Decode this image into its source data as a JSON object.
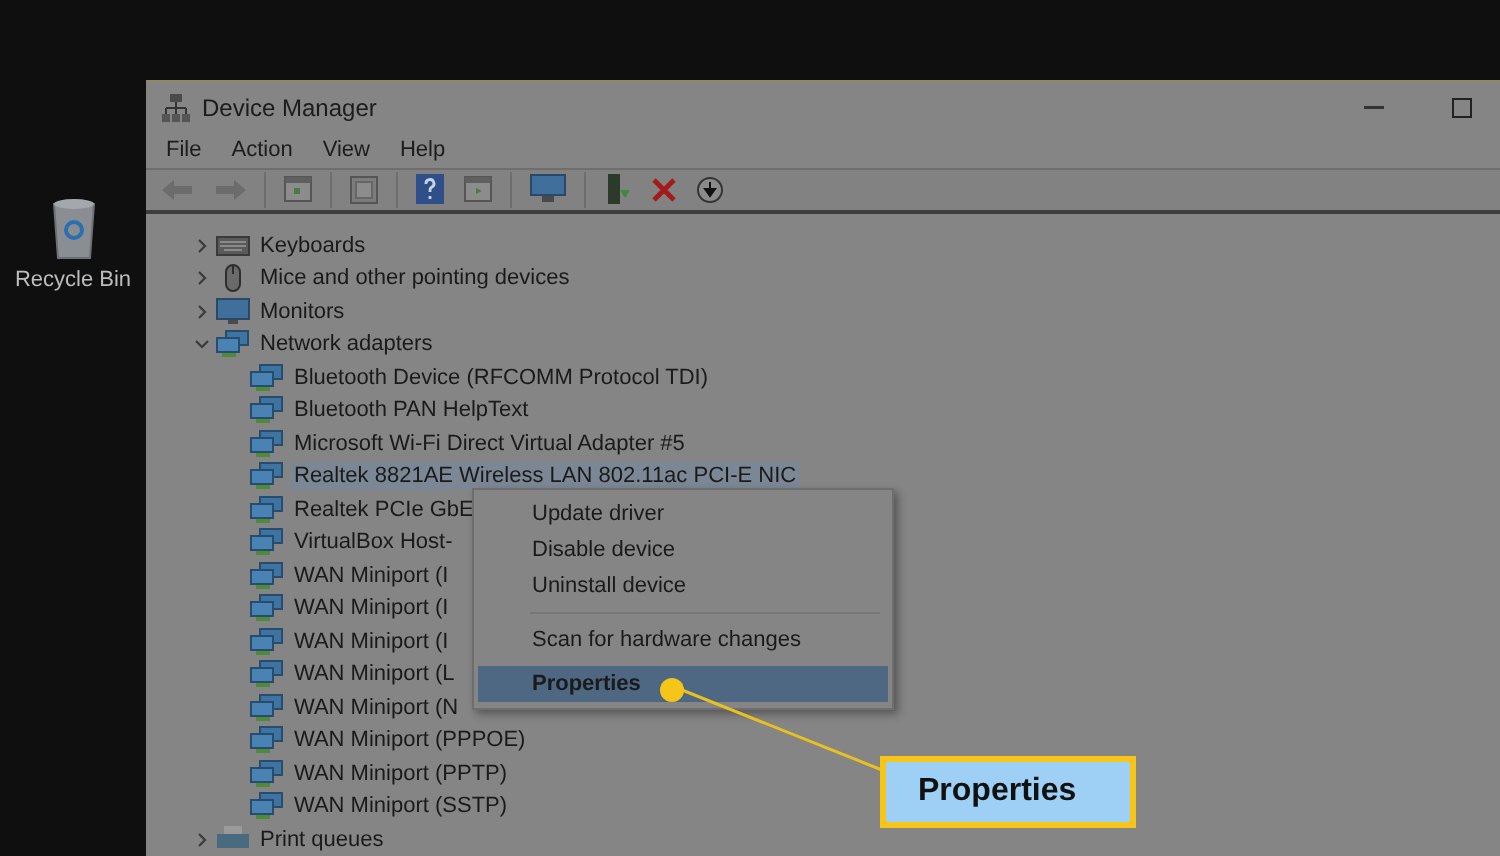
{
  "desktop": {
    "icons": [
      {
        "label": "Recycle Bin"
      }
    ]
  },
  "window": {
    "title": "Device Manager"
  },
  "menu_bar": [
    "File",
    "Action",
    "View",
    "Help"
  ],
  "tree": [
    {
      "label": "Keyboards",
      "expanded": false
    },
    {
      "label": "Mice and other pointing devices",
      "expanded": false
    },
    {
      "label": "Monitors",
      "expanded": false
    },
    {
      "label": "Network adapters",
      "expanded": true,
      "children": [
        {
          "label": "Bluetooth Device (RFCOMM Protocol TDI)",
          "selected": false
        },
        {
          "label": "Bluetooth PAN HelpText",
          "selected": false
        },
        {
          "label": "Microsoft Wi-Fi Direct Virtual Adapter #5",
          "selected": false
        },
        {
          "label": "Realtek 8821AE Wireless LAN 802.11ac PCI-E NIC",
          "selected": true
        },
        {
          "label": "Realtek PCIe GbE",
          "selected": false
        },
        {
          "label": "VirtualBox Host-",
          "selected": false
        },
        {
          "label": "WAN Miniport (I",
          "selected": false
        },
        {
          "label": "WAN Miniport (I",
          "selected": false
        },
        {
          "label": "WAN Miniport (I",
          "selected": false
        },
        {
          "label": "WAN Miniport (L",
          "selected": false
        },
        {
          "label": "WAN Miniport (N",
          "selected": false
        },
        {
          "label": "WAN Miniport (PPPOE)",
          "selected": false
        },
        {
          "label": "WAN Miniport (PPTP)",
          "selected": false
        },
        {
          "label": "WAN Miniport (SSTP)",
          "selected": false
        }
      ]
    },
    {
      "label": "Print queues",
      "expanded": false
    }
  ],
  "context_menu": {
    "items": [
      {
        "label": "Update driver",
        "selected": false,
        "separator_before": false
      },
      {
        "label": "Disable device",
        "selected": false,
        "separator_before": false
      },
      {
        "label": "Uninstall device",
        "selected": false,
        "separator_before": false
      },
      {
        "label": "Scan for hardware changes",
        "selected": false,
        "separator_before": true
      },
      {
        "label": "Properties",
        "selected": true,
        "separator_before": false
      }
    ]
  },
  "callout": {
    "label": "Properties"
  }
}
